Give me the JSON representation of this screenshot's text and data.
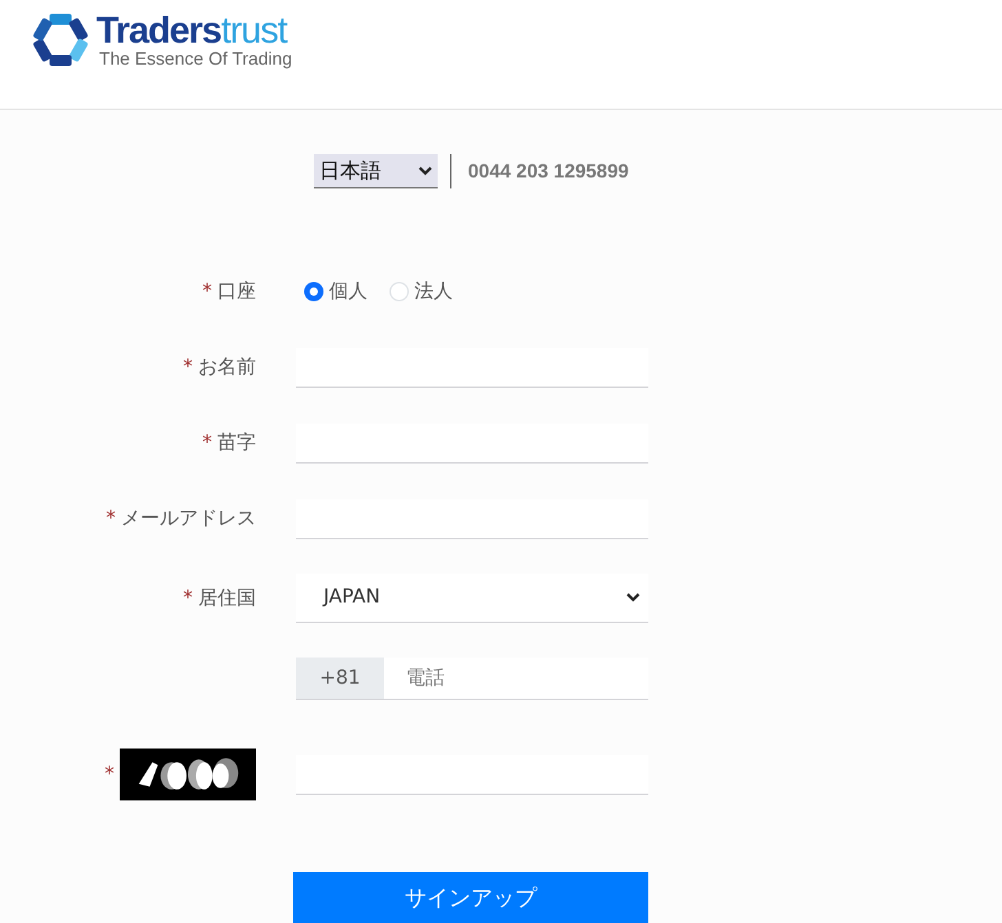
{
  "header": {
    "logo": {
      "name_parts": [
        "Traders",
        "trust"
      ],
      "tagline": "The Essence Of Trading"
    }
  },
  "language_select": {
    "value": "日本語"
  },
  "phone_number": "0044 203 1295899",
  "form": {
    "fields": [
      {
        "kind": "radio",
        "marker": "*",
        "label": "口座",
        "options": [
          {
            "label": "個人",
            "selected": true
          },
          {
            "label": "法人",
            "selected": false
          }
        ]
      },
      {
        "kind": "text",
        "marker": "*",
        "label": "お名前"
      },
      {
        "kind": "text",
        "marker": "*",
        "label": "苗字"
      },
      {
        "kind": "text",
        "marker": "*",
        "label": "メールアドレス"
      },
      {
        "kind": "select",
        "marker": "*",
        "label": "居住国",
        "value": "JAPAN"
      },
      {
        "kind": "phone",
        "prefix": "+81",
        "placeholder": "電話"
      },
      {
        "kind": "captcha",
        "marker": "*"
      }
    ]
  },
  "submit_button": "サインアップ"
}
